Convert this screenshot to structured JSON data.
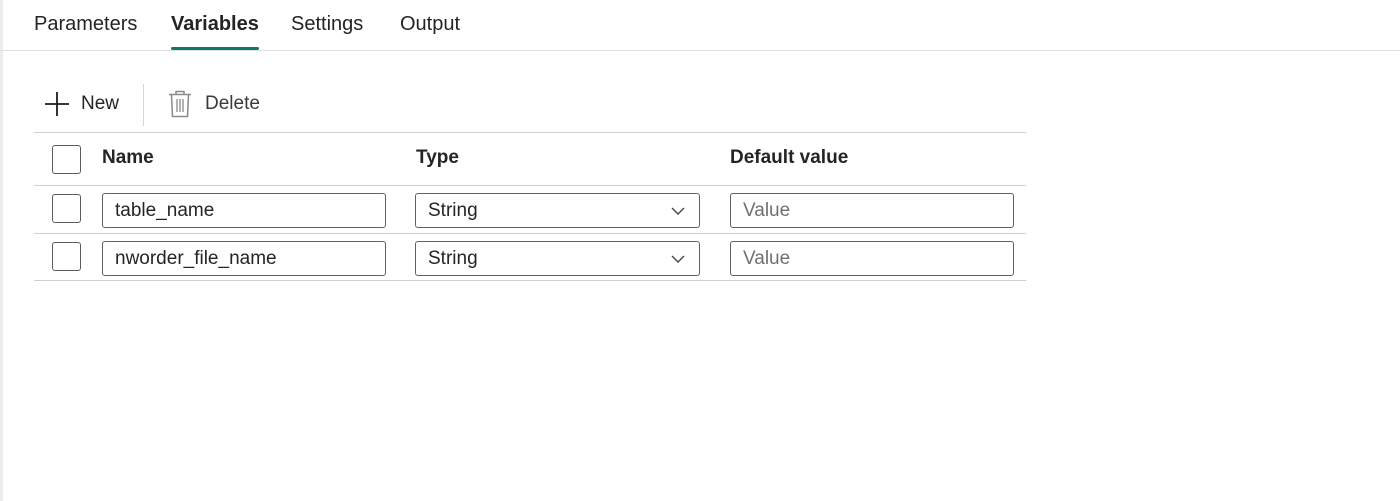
{
  "tabs": [
    {
      "label": "Parameters",
      "active": false
    },
    {
      "label": "Variables",
      "active": true
    },
    {
      "label": "Settings",
      "active": false
    },
    {
      "label": "Output",
      "active": false
    }
  ],
  "toolbar": {
    "new_label": "New",
    "delete_label": "Delete",
    "new_icon": "plus-icon",
    "delete_icon": "trash-icon"
  },
  "grid": {
    "columns": [
      "Name",
      "Type",
      "Default value"
    ],
    "rows": [
      {
        "name": "table_name",
        "type": "String",
        "default_value": "",
        "default_placeholder": "Value"
      },
      {
        "name": "nworder_file_name",
        "type": "String",
        "default_value": "",
        "default_placeholder": "Value"
      }
    ]
  },
  "colors": {
    "accent": "#117865",
    "text": "#242424",
    "border": "#d1d1d1"
  }
}
